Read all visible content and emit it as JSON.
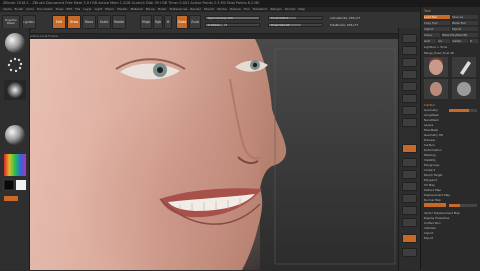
{
  "window_title": "ZBrush 2018.1 - ZBrush Document  Free Mem 3.0+GB  Active Mem 1.2GB  Scratch Disk 55+GB  Timer 0.001  Active Points 2.5 Mil  Total Points 8.2 Mil",
  "menus": [
    "Alpha",
    "Brush",
    "Color",
    "Document",
    "Draw",
    "Edit",
    "File",
    "Layer",
    "Light",
    "Macro",
    "Marker",
    "Material",
    "Movie",
    "Picker",
    "Preferences",
    "Render",
    "Stencil",
    "Stroke",
    "Texture",
    "Tool",
    "Transform",
    "Zplugin",
    "Zscript",
    "Help"
  ],
  "toolbar": {
    "buttons": [
      "Edit",
      "Draw",
      "Move",
      "Scale",
      "Rotate"
    ],
    "mrgb": "Mrgb",
    "rgb": "Rgb",
    "m": "M",
    "zadd": "Zadd",
    "zsub": "Zsub",
    "rgb_intensity": "Rgb Intensity 100",
    "z_intensity": "Z Intensity 25",
    "focal_shift": "Focal Shift 0",
    "draw_size": "Draw Size 64",
    "active_points": "ActivePoints: 238,177",
    "total_points": "TotalPoints: 238,177",
    "projection_master": "Projection Master",
    "lightbox": "LightBox"
  },
  "subbar_text": "Switch Floor   Perspective   Local   Frame",
  "levels": {
    "rgb_intensity": 1.0,
    "z_intensity": 0.25,
    "focal_shift": 0.5,
    "draw_size": 0.6
  },
  "tray": {
    "title": "Tool",
    "items": [
      "Load Tool",
      "Save As",
      "Copy Tool",
      "Paste Tool",
      "Import",
      "Export",
      "Clone",
      "Make PolyMesh3D",
      "GoZ",
      "All",
      "Visible",
      "R",
      "Lightbox > Tools",
      "Merge_Head_Final 48"
    ],
    "subtool_header": "SubTool",
    "subtools": [
      "Geometry",
      "ArrayMesh",
      "NanoMesh",
      "Layers",
      "FiberMesh",
      "Geometry HD",
      "Preview",
      "Surface",
      "Deformation",
      "Masking",
      "Visibility",
      "Polygroups",
      "Contact",
      "Morph Target",
      "Polypaint",
      "UV Map",
      "Texture Map",
      "Displacement Map",
      "Normal Map",
      "Vector Displacement Map",
      "Display Properties",
      "Unified Skin",
      "Initialize",
      "Import",
      "Export"
    ],
    "levels": {
      "sdiv": 0.7,
      "smooth": 0.4
    }
  },
  "colors": {
    "accent": "#c76a28",
    "bg": "#2b2b2b",
    "canvas": "#3a3a3a",
    "skin": "#d9a899"
  },
  "icons": {
    "brush": "sphere-brush-icon",
    "stroke": "stroke-dots-icon",
    "alpha": "alpha-spot-icon",
    "material": "material-sphere-icon",
    "color": "color-picker-icon"
  }
}
